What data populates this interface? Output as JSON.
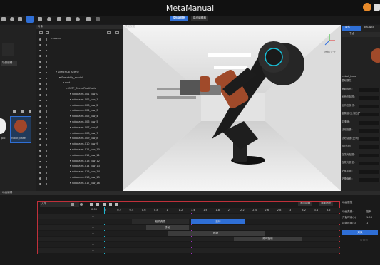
{
  "app": {
    "title": "MetaManual"
  },
  "toolbar": {
    "tab1": "模板编辑器",
    "tab2": "路径编辑器"
  },
  "assets": [
    {
      "label": "场景编辑"
    },
    {
      "label": "plo"
    },
    {
      "label": "robot_base"
    }
  ],
  "tree": {
    "header": "对象",
    "rows": [
      "scene",
      "",
      "",
      "",
      "",
      "",
      "SketchUp_Scene",
      "SketchUp_model",
      "root",
      "GLTF_SceneRootNode",
      "robotarm.001_low_0",
      "robotarm.002_low_1",
      "robotarm.003_low_2",
      "robotarm.004_low_3",
      "robotarm.005_low_4",
      "robotarm.006_low_5",
      "robotarm.007_low_6",
      "robotarm.008_low_7",
      "robotarm.009_low_8",
      "robotarm.010_low_9",
      "robotarm.011_low_10",
      "robotarm.012_low_11",
      "robotarm.013_low_12",
      "robotarm.014_low_13",
      "robotarm.015_low_14",
      "robotarm.016_low_15",
      "robotarm.017_low_16"
    ]
  },
  "viewport": {
    "header": "预览视图",
    "gizmo_label": "透视/正交"
  },
  "props": {
    "tab1": "属性",
    "tab2": "组件库存",
    "subtab": "节点",
    "node_name": "robot_base",
    "rows": [
      "基础属性",
      "基础颜色:",
      "固有色贴图:",
      "固有色操作:",
      "金属度/光滑贴图:",
      "平滑度:",
      "法线贴图:",
      "法线强度(比例):",
      "AO贴图:",
      "自发光贴图:",
      "自发光颜色:",
      "贴图平铺:",
      "贴图偏移:"
    ]
  },
  "anim": {
    "header": "动画编辑",
    "mode": "入场",
    "btn1": "添加动画",
    "btn2": "添加指令",
    "time": "0:00",
    "ticks": [
      "0",
      "0.2",
      "0.4",
      "0.6",
      "0.8",
      "1",
      "1.2",
      "1.4",
      "1.6",
      "1.8",
      "2",
      "2.2",
      "2.4",
      "2.6",
      "2.8",
      "3",
      "3.2",
      "3.4",
      "3.6"
    ],
    "row_labels": [
      "...",
      "...",
      "...",
      "...",
      "...",
      "...",
      "..."
    ],
    "bars": [
      {
        "label": "相机资源",
        "row": 1,
        "start": 0.12,
        "end": 0.36,
        "color": "#2a2a2a"
      },
      {
        "label": "旋转",
        "row": 1,
        "start": 0.37,
        "end": 0.6,
        "color": "#2f6fd6"
      },
      {
        "label": "移动",
        "row": 2,
        "start": 0.18,
        "end": 0.36,
        "color": "#3c3c3c"
      },
      {
        "label": "移动",
        "row": 3,
        "start": 0.27,
        "end": 0.68,
        "color": "#3c3c3c"
      },
      {
        "label": "顺时旋转",
        "row": 4,
        "start": 0.55,
        "end": 0.84,
        "color": "#3c3c3c"
      }
    ],
    "props_header": "动画属性",
    "props": [
      {
        "k": "动画类型:",
        "v": "旋转"
      },
      {
        "k": "开始时间(s):",
        "v": "1.56"
      },
      {
        "k": "持续时间(s):",
        "v": "1"
      }
    ],
    "apply": "对象",
    "extra": "应用到"
  }
}
